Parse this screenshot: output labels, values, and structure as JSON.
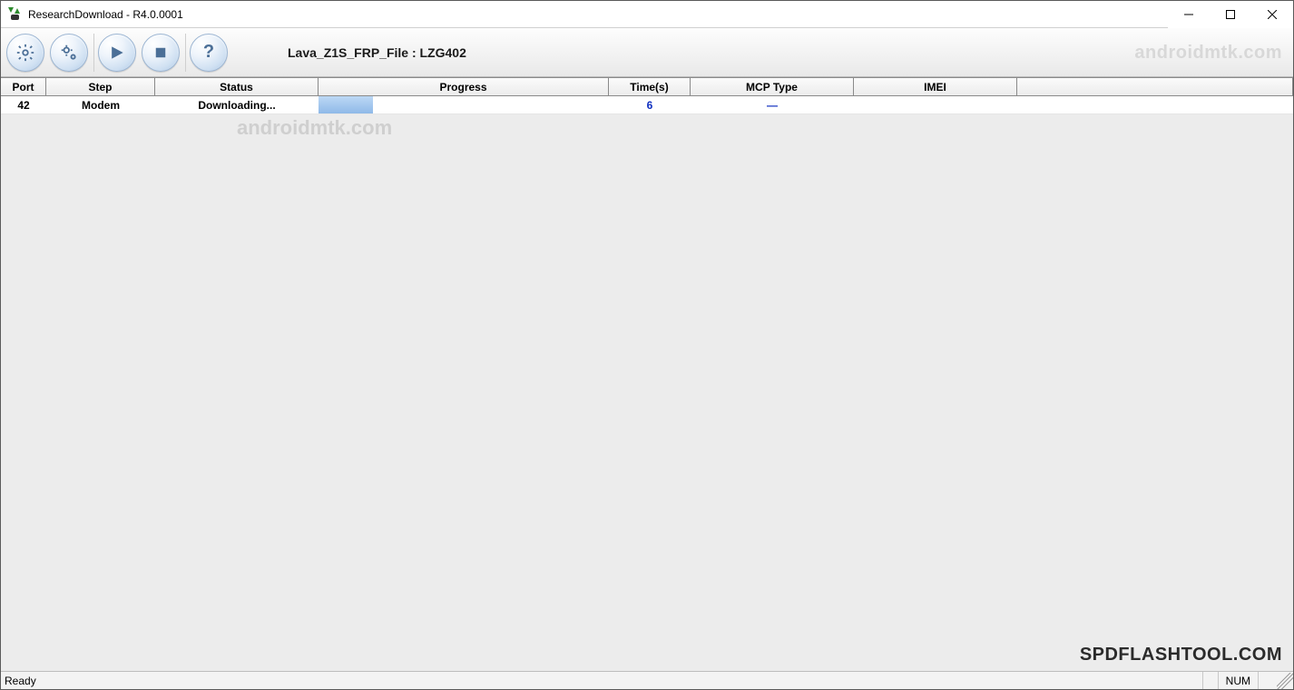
{
  "window": {
    "title": "ResearchDownload - R4.0.0001"
  },
  "toolbar": {
    "file_label": "Lava_Z1S_FRP_File : LZG402",
    "watermark": "androidmtk.com"
  },
  "columns": {
    "port": "Port",
    "step": "Step",
    "status": "Status",
    "progress": "Progress",
    "time": "Time(s)",
    "mcp": "MCP Type",
    "imei": "IMEI"
  },
  "rows": [
    {
      "port": "42",
      "step": "Modem",
      "status": "Downloading...",
      "time": "6",
      "mcp": "—",
      "imei": ""
    }
  ],
  "watermarks": {
    "mid": "androidmtk.com",
    "br": "SPDFLASHTOOL.COM"
  },
  "statusbar": {
    "ready": "Ready",
    "num": "NUM"
  }
}
